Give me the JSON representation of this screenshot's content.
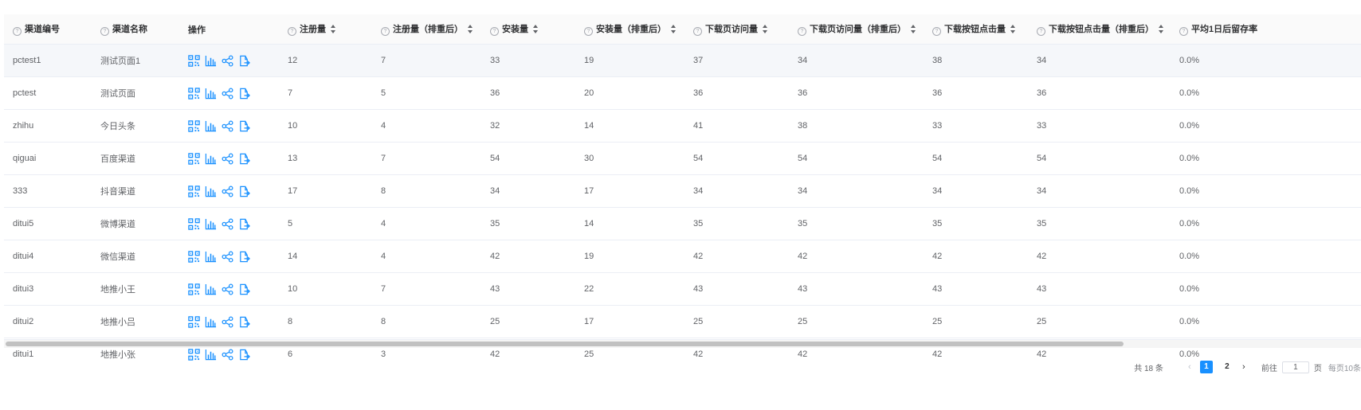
{
  "table": {
    "columns": [
      {
        "label": "渠道编号",
        "help": true,
        "sortable": false
      },
      {
        "label": "渠道名称",
        "help": true,
        "sortable": false
      },
      {
        "label": "操作",
        "help": false,
        "sortable": false
      },
      {
        "label": "注册量",
        "help": true,
        "sortable": true
      },
      {
        "label": "注册量（排重后）",
        "help": true,
        "sortable": true
      },
      {
        "label": "安装量",
        "help": true,
        "sortable": true
      },
      {
        "label": "安装量（排重后）",
        "help": true,
        "sortable": true
      },
      {
        "label": "下载页访问量",
        "help": true,
        "sortable": true
      },
      {
        "label": "下载页访问量（排重后）",
        "help": true,
        "sortable": true
      },
      {
        "label": "下载按钮点击量",
        "help": true,
        "sortable": true
      },
      {
        "label": "下载按钮点击量（排重后）",
        "help": true,
        "sortable": true
      },
      {
        "label": "平均1日后留存率",
        "help": true,
        "sortable": false
      }
    ],
    "action_icons": [
      "qrcode-icon",
      "bar-chart-icon",
      "share-icon",
      "export-icon"
    ],
    "rows": [
      {
        "id": "pctest1",
        "name": "测试页面1",
        "reg": "12",
        "reg_dedup": "7",
        "install": "33",
        "install_dedup": "19",
        "visit": "37",
        "visit_dedup": "34",
        "click": "38",
        "click_dedup": "34",
        "retention": "0.0%"
      },
      {
        "id": "pctest",
        "name": "测试页面",
        "reg": "7",
        "reg_dedup": "5",
        "install": "36",
        "install_dedup": "20",
        "visit": "36",
        "visit_dedup": "36",
        "click": "36",
        "click_dedup": "36",
        "retention": "0.0%"
      },
      {
        "id": "zhihu",
        "name": "今日头条",
        "reg": "10",
        "reg_dedup": "4",
        "install": "32",
        "install_dedup": "14",
        "visit": "41",
        "visit_dedup": "38",
        "click": "33",
        "click_dedup": "33",
        "retention": "0.0%"
      },
      {
        "id": "qiguai",
        "name": "百度渠道",
        "reg": "13",
        "reg_dedup": "7",
        "install": "54",
        "install_dedup": "30",
        "visit": "54",
        "visit_dedup": "54",
        "click": "54",
        "click_dedup": "54",
        "retention": "0.0%"
      },
      {
        "id": "333",
        "name": "抖音渠道",
        "reg": "17",
        "reg_dedup": "8",
        "install": "34",
        "install_dedup": "17",
        "visit": "34",
        "visit_dedup": "34",
        "click": "34",
        "click_dedup": "34",
        "retention": "0.0%"
      },
      {
        "id": "ditui5",
        "name": "微博渠道",
        "reg": "5",
        "reg_dedup": "4",
        "install": "35",
        "install_dedup": "14",
        "visit": "35",
        "visit_dedup": "35",
        "click": "35",
        "click_dedup": "35",
        "retention": "0.0%"
      },
      {
        "id": "ditui4",
        "name": "微信渠道",
        "reg": "14",
        "reg_dedup": "4",
        "install": "42",
        "install_dedup": "19",
        "visit": "42",
        "visit_dedup": "42",
        "click": "42",
        "click_dedup": "42",
        "retention": "0.0%"
      },
      {
        "id": "ditui3",
        "name": "地推小王",
        "reg": "10",
        "reg_dedup": "7",
        "install": "43",
        "install_dedup": "22",
        "visit": "43",
        "visit_dedup": "43",
        "click": "43",
        "click_dedup": "43",
        "retention": "0.0%"
      },
      {
        "id": "ditui2",
        "name": "地推小吕",
        "reg": "8",
        "reg_dedup": "8",
        "install": "25",
        "install_dedup": "17",
        "visit": "25",
        "visit_dedup": "25",
        "click": "25",
        "click_dedup": "25",
        "retention": "0.0%"
      },
      {
        "id": "ditui1",
        "name": "地推小张",
        "reg": "6",
        "reg_dedup": "3",
        "install": "42",
        "install_dedup": "25",
        "visit": "42",
        "visit_dedup": "42",
        "click": "42",
        "click_dedup": "42",
        "retention": "0.0%"
      }
    ]
  },
  "pagination": {
    "total": "共 18 条",
    "prev_label": "‹",
    "pages": [
      "1",
      "2"
    ],
    "current": "1",
    "next_label": "›",
    "goto_label": "前往",
    "goto_value": "1",
    "page_suffix": "页",
    "page_size": "每页10条"
  },
  "colors": {
    "accent": "#1890ff",
    "highlight_row": "#f5f7fa",
    "border": "#ebeef5"
  }
}
